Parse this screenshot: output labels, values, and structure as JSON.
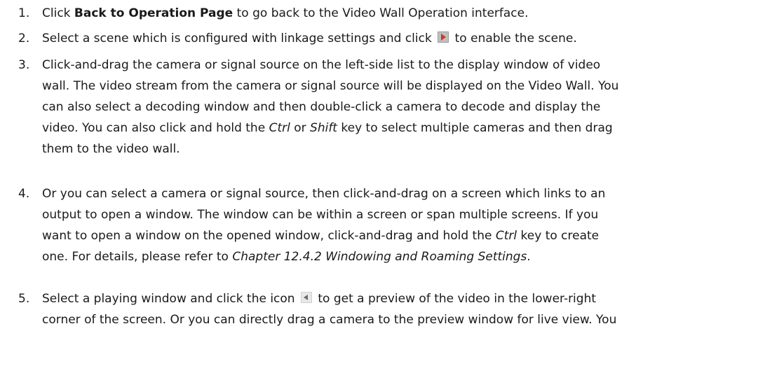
{
  "steps": [
    {
      "number": "1.",
      "pre": "Click ",
      "bold": "Back to Operation Page",
      "post": " to go back to the Video Wall Operation interface."
    },
    {
      "number": "2.",
      "pre": "Select a scene which is configured with linkage settings and click ",
      "icon": "play-enable-icon",
      "post": " to enable the scene."
    },
    {
      "number": "3.",
      "line1": "Click-and-drag the camera or signal source on the left-side list to the display window of video",
      "line2": "wall. The video stream from the camera or signal source will be displayed on the Video Wall. You",
      "line3": "can also select a decoding window and then double-click a camera to decode and display the",
      "line4_pre": "video. You can also click and hold the ",
      "line4_italic1": "Ctrl",
      "line4_mid": " or ",
      "line4_italic2": "Shift",
      "line4_post": " key to select multiple cameras and then drag",
      "line5": "them to the video wall."
    },
    {
      "number": "4.",
      "line1": "Or you can select a camera or signal source, then click-and-drag on a screen which links to an",
      "line2": "output to open a window. The window can be within a screen or span multiple screens. If you",
      "line3_pre": "want to open a window on the opened window, click-and-drag and hold the ",
      "line3_italic": "Ctrl",
      "line3_post": " key to create",
      "line4_pre": "one. For details, please refer to ",
      "line4_italic": "Chapter 12.4.2 Windowing and Roaming Settings",
      "line4_post": "."
    },
    {
      "number": "5.",
      "line1_pre": "Select a playing window and click the icon ",
      "icon": "preview-arrow-icon",
      "line1_post": " to get a preview of the video in the lower-right",
      "line2": "corner of the screen. Or you can directly drag a camera to the preview window for live view. You"
    }
  ]
}
